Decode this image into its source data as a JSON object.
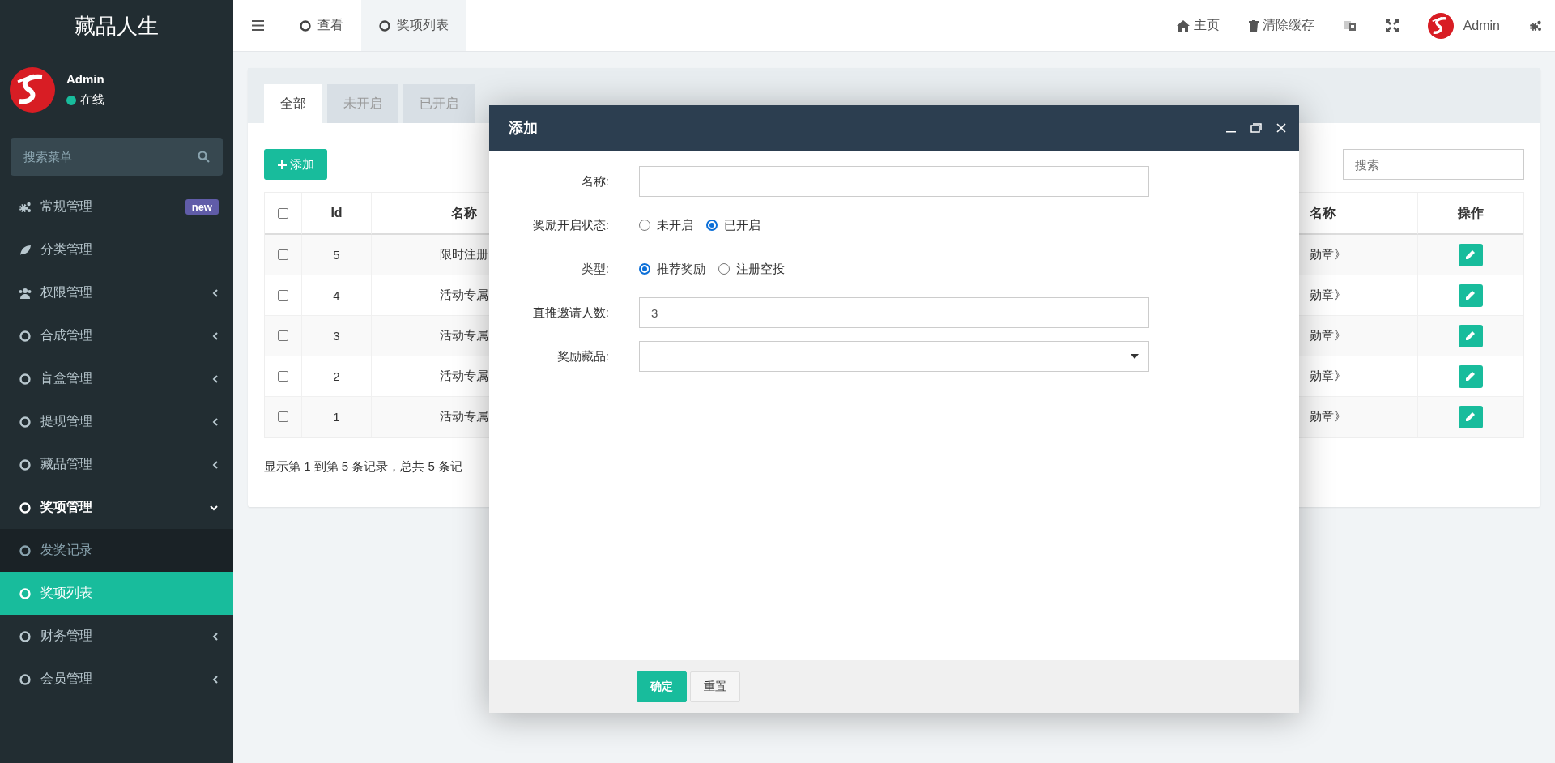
{
  "sidebar": {
    "title": "藏品人生",
    "user": {
      "name": "Admin",
      "status": "在线"
    },
    "search": {
      "placeholder": "搜索菜单"
    },
    "menu": [
      {
        "kind": "link",
        "label": "常规管理",
        "badge": "new",
        "selected": false
      },
      {
        "kind": "link",
        "label": "分类管理",
        "selected": false
      },
      {
        "kind": "group",
        "label": "权限管理",
        "expanded": false
      },
      {
        "kind": "group",
        "label": "合成管理",
        "expanded": false
      },
      {
        "kind": "group",
        "label": "盲盒管理",
        "expanded": false
      },
      {
        "kind": "group",
        "label": "提现管理",
        "expanded": false
      },
      {
        "kind": "group",
        "label": "藏品管理",
        "expanded": false
      },
      {
        "kind": "group",
        "label": "奖项管理",
        "expanded": true,
        "children": [
          {
            "label": "发奖记录",
            "selected": false
          },
          {
            "label": "奖项列表",
            "selected": true
          }
        ]
      },
      {
        "kind": "group",
        "label": "财务管理",
        "expanded": false
      },
      {
        "kind": "group",
        "label": "会员管理",
        "expanded": false
      }
    ]
  },
  "header": {
    "tabs": [
      {
        "label": "查看",
        "selected": false
      },
      {
        "label": "奖项列表",
        "selected": true
      }
    ],
    "links": [
      "主页",
      "清除缓存"
    ],
    "user": {
      "name": "Admin"
    }
  },
  "panel": {
    "tabs": [
      {
        "label": "全部",
        "selected": true
      },
      {
        "label": "未开启",
        "selected": false
      },
      {
        "label": "已开启",
        "selected": false
      }
    ],
    "add_button": "添加",
    "search": {
      "placeholder": "搜索"
    },
    "table": {
      "select_all_checked": false,
      "columns": [
        "Id",
        "名称",
        "名称",
        "操作"
      ],
      "rows": [
        {
          "checked": false,
          "cells": [
            "5",
            "限时注册",
            "勋章》"
          ]
        },
        {
          "checked": false,
          "cells": [
            "4",
            "活动专属",
            "勋章》"
          ]
        },
        {
          "checked": false,
          "cells": [
            "3",
            "活动专属",
            "勋章》"
          ]
        },
        {
          "checked": false,
          "cells": [
            "2",
            "活动专属",
            "勋章》"
          ]
        },
        {
          "checked": false,
          "cells": [
            "1",
            "活动专属",
            "勋章》"
          ]
        }
      ]
    },
    "info": "显示第 1 到第 5 条记录，总共 5 条记"
  },
  "modal": {
    "title": "添加",
    "fields": [
      {
        "kind": "text",
        "label": "名称:"
      },
      {
        "kind": "radio",
        "label": "奖励开启状态:",
        "options": [
          {
            "label": "未开启",
            "selected": false
          },
          {
            "label": "已开启",
            "selected": true
          }
        ]
      },
      {
        "kind": "radio",
        "label": "类型:",
        "options": [
          {
            "label": "推荐奖励",
            "selected": true
          },
          {
            "label": "注册空投",
            "selected": false
          }
        ]
      },
      {
        "kind": "text",
        "label": "直推邀请人数:",
        "value": "3"
      },
      {
        "kind": "select",
        "label": "奖励藏品:"
      }
    ],
    "buttons": [
      {
        "kind": "primary",
        "label": "确定"
      },
      {
        "kind": "default",
        "label": "重置"
      }
    ]
  }
}
